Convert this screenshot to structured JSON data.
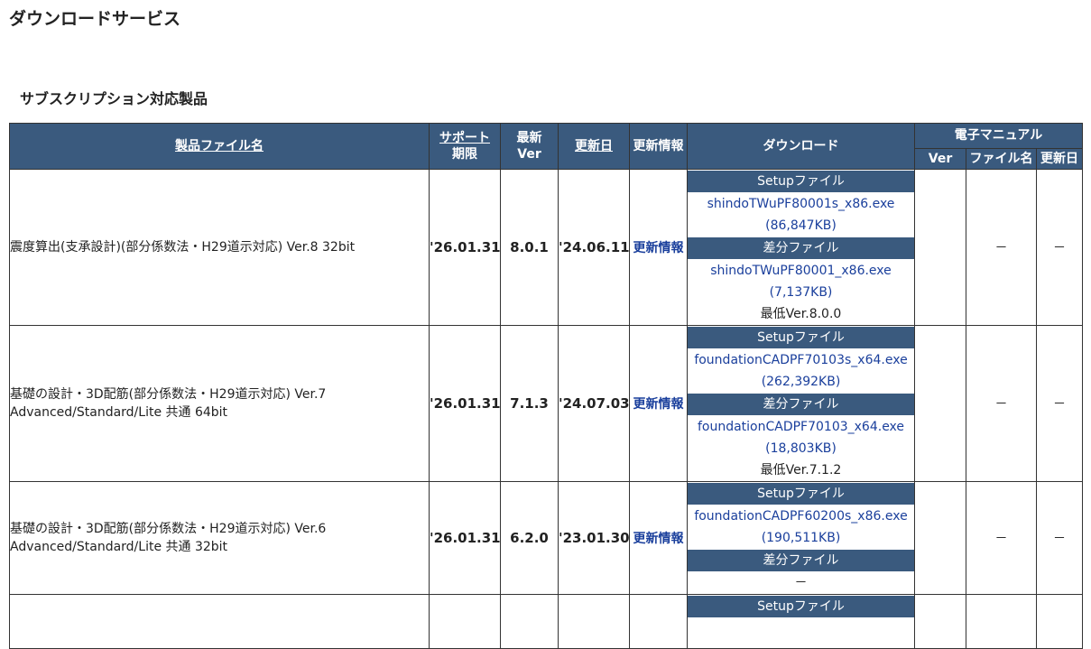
{
  "page_title": "ダウンロードサービス",
  "section_title": "サブスクリプション対応製品",
  "headers": {
    "product": "製品ファイル名",
    "support_1": "サポート",
    "support_2": "期限",
    "latest_1": "最新",
    "latest_2": "Ver",
    "updated": "更新日",
    "update_info": "更新情報",
    "download": "ダウンロード",
    "manual": "電子マニュアル",
    "man_ver": "Ver",
    "man_file": "ファイル名",
    "man_date": "更新日"
  },
  "rows": [
    {
      "name_1": "震度算出(支承設計)(部分係数法・H29道示対応) Ver.8 32bit",
      "name_2": "",
      "support": "'26.01.31",
      "ver": "8.0.1",
      "updated": "'24.06.11",
      "info": "更新情報",
      "setup_label": "Setupファイル",
      "setup_file": "shindoTWuPF80001s_x86.exe",
      "setup_size": "(86,847KB)",
      "diff_label": "差分ファイル",
      "diff_file": "shindoTWuPF80001_x86.exe",
      "diff_size": "(7,137KB)",
      "min_ver": "最低Ver.8.0.0",
      "man_ver": "",
      "man_file": "－",
      "man_date": "－"
    },
    {
      "name_1": "基礎の設計・3D配筋(部分係数法・H29道示対応) Ver.7",
      "name_2": "Advanced/Standard/Lite 共通 64bit",
      "support": "'26.01.31",
      "ver": "7.1.3",
      "updated": "'24.07.03",
      "info": "更新情報",
      "setup_label": "Setupファイル",
      "setup_file": "foundationCADPF70103s_x64.exe",
      "setup_size": "(262,392KB)",
      "diff_label": "差分ファイル",
      "diff_file": "foundationCADPF70103_x64.exe",
      "diff_size": "(18,803KB)",
      "min_ver": "最低Ver.7.1.2",
      "man_ver": "",
      "man_file": "－",
      "man_date": "－"
    },
    {
      "name_1": "基礎の設計・3D配筋(部分係数法・H29道示対応) Ver.6",
      "name_2": "Advanced/Standard/Lite 共通 32bit",
      "support": "'26.01.31",
      "ver": "6.2.0",
      "updated": "'23.01.30",
      "info": "更新情報",
      "setup_label": "Setupファイル",
      "setup_file": "foundationCADPF60200s_x86.exe",
      "setup_size": "(190,511KB)",
      "diff_label": "差分ファイル",
      "diff_none": "－",
      "man_ver": "",
      "man_file": "－",
      "man_date": "－"
    },
    {
      "setup_label": "Setupファイル"
    }
  ]
}
